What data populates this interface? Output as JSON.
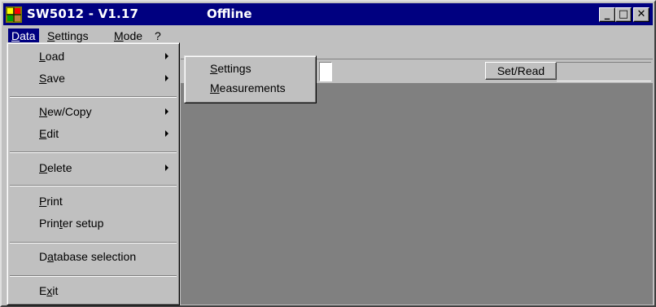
{
  "window": {
    "title": "SW5012 - V1.17",
    "status": "Offline",
    "buttons": {
      "minimize": "_",
      "maximize": "□",
      "close": "✕"
    }
  },
  "menubar": {
    "items": [
      {
        "pre": "",
        "u": "D",
        "post": "ata"
      },
      {
        "pre": "",
        "u": "S",
        "post": "ettings"
      },
      {
        "pre": "",
        "u": "M",
        "post": "ode"
      },
      {
        "pre": "?",
        "u": "",
        "post": ""
      }
    ]
  },
  "toolbar": {
    "set_read_label": "Set/Read"
  },
  "data_menu": {
    "load": {
      "pre": "",
      "u": "L",
      "post": "oad"
    },
    "save": {
      "pre": "",
      "u": "S",
      "post": "ave"
    },
    "new_copy": {
      "pre": "",
      "u": "N",
      "post": "ew/Copy"
    },
    "edit": {
      "pre": "",
      "u": "E",
      "post": "dit"
    },
    "delete": {
      "pre": "",
      "u": "D",
      "post": "elete"
    },
    "print": {
      "pre": "",
      "u": "P",
      "post": "rint"
    },
    "printer_setup": {
      "pre": "Prin",
      "u": "t",
      "post": "er setup"
    },
    "database_selection": {
      "pre": "D",
      "u": "a",
      "post": "tabase selection"
    },
    "exit": {
      "pre": "E",
      "u": "x",
      "post": "it"
    }
  },
  "load_submenu": {
    "settings": {
      "pre": "",
      "u": "S",
      "post": "ettings"
    },
    "measurements": {
      "pre": "",
      "u": "M",
      "post": "easurements"
    }
  },
  "icons": {
    "app": "app-logo-icon",
    "submenu": "submenu-arrow-icon"
  }
}
